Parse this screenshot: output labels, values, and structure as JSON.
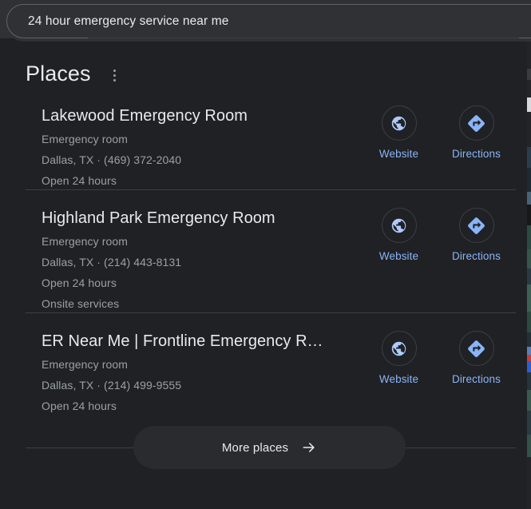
{
  "search": {
    "query": "24 hour emergency service near me",
    "placeholder": "Search"
  },
  "section": {
    "title": "Places",
    "menu_icon": "more-vert-icon"
  },
  "colors": {
    "background": "#202124",
    "surface": "#303134",
    "divider": "#3c4043",
    "primary_text": "#e8eaed",
    "secondary_text": "#9aa0a6",
    "link_accent": "#8ab4f8",
    "pill_background": "#2a2b2e"
  },
  "actions": {
    "website_label": "Website",
    "website_icon": "globe-icon",
    "directions_label": "Directions",
    "directions_icon": "directions-arrow-icon"
  },
  "places": [
    {
      "name": "Lakewood Emergency Room",
      "category": "Emergency room",
      "location_phone": "Dallas, TX · (469) 372-2040",
      "hours": "Open 24 hours",
      "services": ""
    },
    {
      "name": "Highland Park Emergency Room",
      "category": "Emergency room",
      "location_phone": "Dallas, TX · (214) 443-8131",
      "hours": "Open 24 hours",
      "services": "Onsite services"
    },
    {
      "name": "ER Near Me | Frontline Emergency R…",
      "category": "Emergency room",
      "location_phone": "Dallas, TX · (214) 499-9555",
      "hours": "Open 24 hours",
      "services": ""
    }
  ],
  "footer": {
    "more_places_label": "More places",
    "more_places_icon": "arrow-right-icon"
  }
}
